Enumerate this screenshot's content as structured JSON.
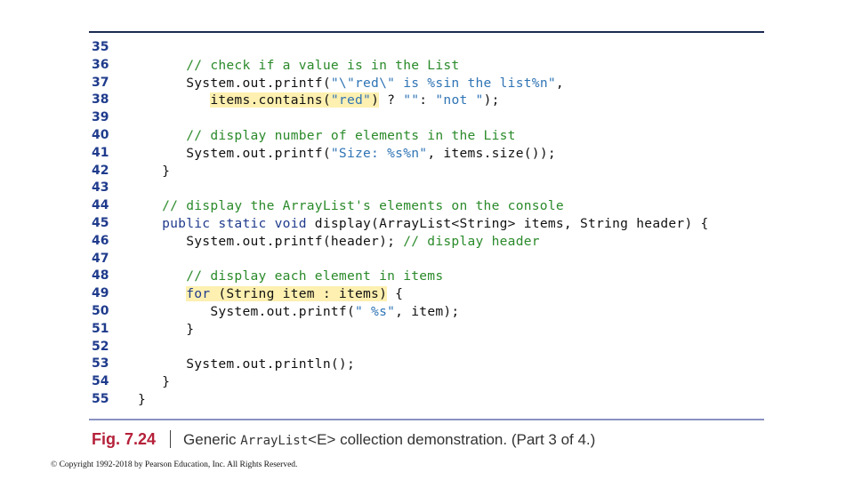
{
  "code_listing": {
    "lines": [
      {
        "number": "35",
        "indent": "",
        "tokens": []
      },
      {
        "number": "36",
        "indent": "      ",
        "tokens": [
          {
            "type": "comment",
            "text": "// check if a value is in the List"
          }
        ]
      },
      {
        "number": "37",
        "indent": "      ",
        "tokens": [
          {
            "type": "plain",
            "text": "System.out.printf("
          },
          {
            "type": "str",
            "text": "\"\\\"red\\\" is %sin the list%n\""
          },
          {
            "type": "plain",
            "text": ","
          }
        ]
      },
      {
        "number": "38",
        "indent": "         ",
        "tokens": [
          {
            "type": "plain",
            "text": "items.contains(",
            "highlight": true
          },
          {
            "type": "str",
            "text": "\"red\"",
            "highlight": true
          },
          {
            "type": "plain",
            "text": ")",
            "highlight": true
          },
          {
            "type": "plain",
            "text": " ? "
          },
          {
            "type": "str",
            "text": "\"\""
          },
          {
            "type": "plain",
            "text": ": "
          },
          {
            "type": "str",
            "text": "\"not \""
          },
          {
            "type": "plain",
            "text": ");"
          }
        ]
      },
      {
        "number": "39",
        "indent": "",
        "tokens": []
      },
      {
        "number": "40",
        "indent": "      ",
        "tokens": [
          {
            "type": "comment",
            "text": "// display number of elements in the List"
          }
        ]
      },
      {
        "number": "41",
        "indent": "      ",
        "tokens": [
          {
            "type": "plain",
            "text": "System.out.printf("
          },
          {
            "type": "str",
            "text": "\"Size: %s%n\""
          },
          {
            "type": "plain",
            "text": ", items.size());"
          }
        ]
      },
      {
        "number": "42",
        "indent": "   ",
        "tokens": [
          {
            "type": "plain",
            "text": "}"
          }
        ]
      },
      {
        "number": "43",
        "indent": "",
        "tokens": []
      },
      {
        "number": "44",
        "indent": "   ",
        "tokens": [
          {
            "type": "comment",
            "text": "// display the ArrayList's elements on the console"
          }
        ]
      },
      {
        "number": "45",
        "indent": "   ",
        "tokens": [
          {
            "type": "kw",
            "text": "public static void"
          },
          {
            "type": "plain",
            "text": " display(ArrayList<String> items, String header) {"
          }
        ]
      },
      {
        "number": "46",
        "indent": "      ",
        "tokens": [
          {
            "type": "plain",
            "text": "System.out.printf(header); "
          },
          {
            "type": "comment",
            "text": "// display header"
          }
        ]
      },
      {
        "number": "47",
        "indent": "",
        "tokens": []
      },
      {
        "number": "48",
        "indent": "      ",
        "tokens": [
          {
            "type": "comment",
            "text": "// display each element in items"
          }
        ]
      },
      {
        "number": "49",
        "indent": "      ",
        "tokens": [
          {
            "type": "kw",
            "text": "for",
            "highlight": true
          },
          {
            "type": "plain",
            "text": " (String item : items)",
            "highlight": true
          },
          {
            "type": "plain",
            "text": " {"
          }
        ]
      },
      {
        "number": "50",
        "indent": "         ",
        "tokens": [
          {
            "type": "plain",
            "text": "System.out.printf("
          },
          {
            "type": "str",
            "text": "\" %s\""
          },
          {
            "type": "plain",
            "text": ", item);"
          }
        ]
      },
      {
        "number": "51",
        "indent": "      ",
        "tokens": [
          {
            "type": "plain",
            "text": "}"
          }
        ]
      },
      {
        "number": "52",
        "indent": "",
        "tokens": []
      },
      {
        "number": "53",
        "indent": "      ",
        "tokens": [
          {
            "type": "plain",
            "text": "System.out.println();"
          }
        ]
      },
      {
        "number": "54",
        "indent": "   ",
        "tokens": [
          {
            "type": "plain",
            "text": "}"
          }
        ]
      },
      {
        "number": "55",
        "indent": "",
        "tokens": [
          {
            "type": "plain",
            "text": "}"
          }
        ]
      }
    ]
  },
  "caption": {
    "fig_label": "Fig. 7.24",
    "text_before": "Generic ",
    "mono_text": "ArrayList",
    "generic_param": "<E>",
    "text_after": " collection demonstration. (Part 3 of 4.)"
  },
  "footer": {
    "copyright": "© Copyright 1992-2018 by Pearson Education, Inc. All Rights Reserved."
  },
  "colors": {
    "line_numbers": "#1f3b8c",
    "comment": "#2a8a2a",
    "keyword": "#1f3b8c",
    "string": "#2f74b5",
    "highlight": "#fdf0b0",
    "fig_label": "#b5213a",
    "top_rule": "#1b2a52",
    "bottom_rule": "#8a92c2"
  }
}
